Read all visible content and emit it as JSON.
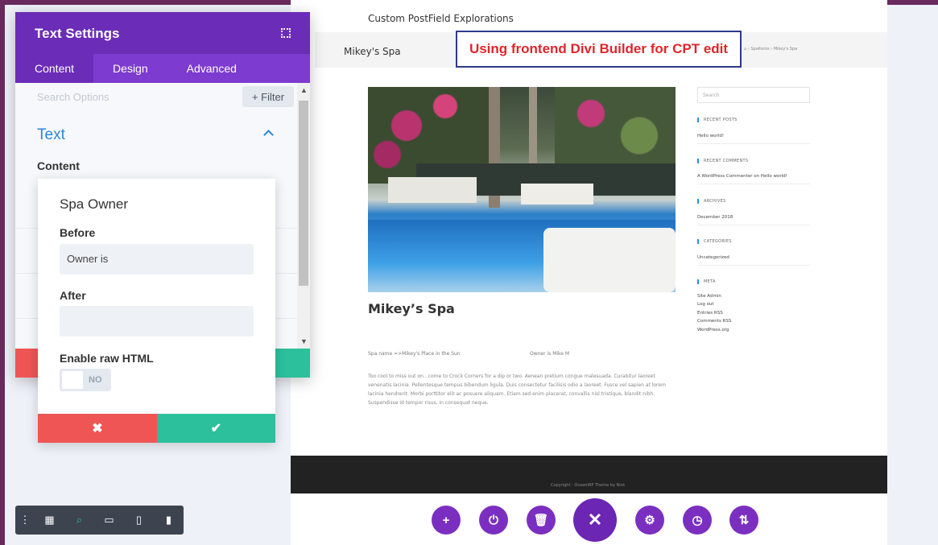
{
  "site": {
    "title": "Custom PostField Explorations",
    "page_name": "Mikey's Spa",
    "breadcrumb": "⌂ › Spaltems › Mikey's Spa",
    "callout": "Using frontend Divi Builder for CPT edit",
    "post_title": "Mikey’s Spa",
    "meta_left": "Spa name =>Mikey's Place in the Sun",
    "meta_right": "Owner is Mike M",
    "body_text": "Too cool to miss out on.. come to Crock Corners for a dip or two. Aenean pretium congue malesuada. Curabitur laoreet venenatis lacinia. Pellentesque tempus bibendum ligula. Duis consectetur facilisis odio a laoreet. Fusce vel sapien at lorem lacinia hendrerit. Morbi porttitor elit ac posuere aliquam. Etiam sed enim placerat, convallis nisl tristique, blandit nibh. Suspendisse id tempor risus, in consequat neque.",
    "sidebar": {
      "search_placeholder": "Search",
      "recent_posts_head": "RECENT POSTS",
      "recent_post": "Hello world!",
      "recent_comments_head": "RECENT COMMENTS",
      "recent_comment": "A WordPress Commenter on Hello world!",
      "archives_head": "ARCHIVES",
      "archive": "December 2018",
      "categories_head": "CATEGORIES",
      "category": "Uncategorized",
      "meta_head": "META",
      "meta_items": [
        "Site Admin",
        "Log out",
        "Entries RSS",
        "Comments RSS",
        "WordPress.org"
      ]
    },
    "footer": "Copyright - OceanWP Theme by Nick"
  },
  "panel": {
    "title": "Text Settings",
    "tabs": [
      "Content",
      "Design",
      "Advanced"
    ],
    "search_placeholder": "Search Options",
    "filter_label": "+ Filter",
    "section_title": "Text",
    "content_label": "Content"
  },
  "card": {
    "title": "Spa Owner",
    "before_label": "Before",
    "before_value": "Owner is",
    "after_label": "After",
    "after_value": "",
    "raw_html_label": "Enable raw HTML",
    "raw_html_state": "NO",
    "cancel_glyph": "✖",
    "save_glyph": "✔"
  },
  "action_bar": {
    "buttons": [
      "+",
      "⏻",
      "🗑",
      "✕",
      "⚙",
      "◷",
      "⇅"
    ]
  },
  "bottom_toolbar": {
    "buttons": [
      "⋮",
      "▦",
      "⌕",
      "▭",
      "▯",
      "▮"
    ]
  }
}
